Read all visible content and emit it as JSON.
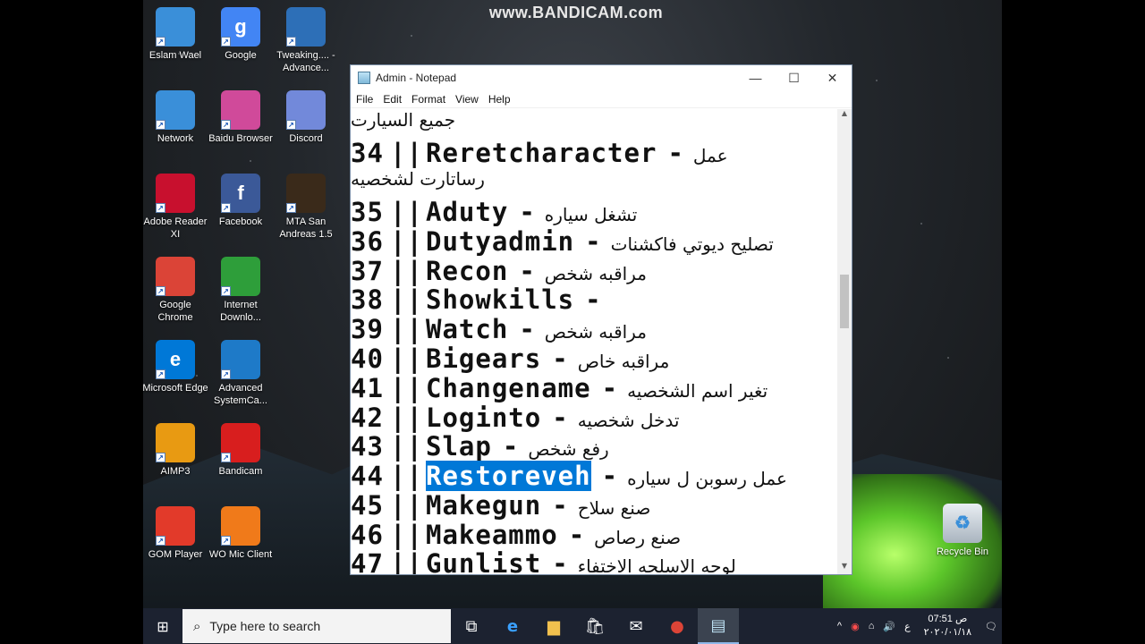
{
  "watermark": "www.BANDICAM.com",
  "desktop_icons": [
    {
      "label": "Eslam Wael",
      "icon": "computer-icon",
      "color": "#3a8fd9"
    },
    {
      "label": "Google",
      "icon": "google-icon",
      "color": "#4285f4",
      "glyph": "g"
    },
    {
      "label": "Tweaking.... - Advance...",
      "icon": "tweaking-icon",
      "color": "#2d6fb7"
    },
    {
      "label": "Network",
      "icon": "network-icon",
      "color": "#3a8fd9"
    },
    {
      "label": "Baidu Browser",
      "icon": "baidu-icon",
      "color": "#d04a9a"
    },
    {
      "label": "Discord",
      "icon": "discord-icon",
      "color": "#7289da"
    },
    {
      "label": "Adobe Reader XI",
      "icon": "adobe-reader-icon",
      "color": "#c8102e"
    },
    {
      "label": "Facebook",
      "icon": "facebook-icon",
      "color": "#3b5998",
      "glyph": "f"
    },
    {
      "label": "MTA San Andreas 1.5",
      "icon": "mta-icon",
      "color": "#3a2a1a"
    },
    {
      "label": "Google Chrome",
      "icon": "chrome-icon",
      "color": "#db4437"
    },
    {
      "label": "Internet Downlo...",
      "icon": "idm-icon",
      "color": "#2e9e3a"
    },
    {
      "label": "Microsoft Edge",
      "icon": "edge-icon",
      "color": "#0078d7",
      "glyph": "e"
    },
    {
      "label": "Advanced SystemCa...",
      "icon": "advanced-systemcare-icon",
      "color": "#1e7ac8"
    },
    {
      "label": "AIMP3",
      "icon": "aimp-icon",
      "color": "#e89a12"
    },
    {
      "label": "Bandicam",
      "icon": "bandicam-icon",
      "color": "#d81e1e"
    },
    {
      "label": "GOM Player",
      "icon": "gom-player-icon",
      "color": "#e23a2a"
    },
    {
      "label": "WO Mic Client",
      "icon": "wo-mic-icon",
      "color": "#f07a1a"
    }
  ],
  "recycle_bin": {
    "label": "Recycle Bin",
    "icon": "recycle-bin-icon"
  },
  "notepad": {
    "title": "Admin - Notepad",
    "menu": [
      "File",
      "Edit",
      "Format",
      "View",
      "Help"
    ],
    "lines": [
      {
        "type": "arabic",
        "text": "جميع السيارت"
      },
      {
        "type": "code",
        "num": "34",
        "bars": "||",
        "cmd": "Reretcharacter",
        "dash": "-",
        "desc": "عمل"
      },
      {
        "type": "arabic",
        "text": "رساتارت لشخصيه"
      },
      {
        "type": "code",
        "num": "35",
        "bars": "||",
        "cmd": "Aduty",
        "dash": "-",
        "desc": "تشغل سياره"
      },
      {
        "type": "code",
        "num": "36",
        "bars": "||",
        "cmd": "Dutyadmin",
        "dash": "-",
        "desc": "تصليح ديوتي فاكشنات"
      },
      {
        "type": "code",
        "num": "37",
        "bars": "||",
        "cmd": "Recon",
        "dash": "-",
        "desc": "مراقبه شخص"
      },
      {
        "type": "code",
        "num": "38",
        "bars": "||",
        "cmd": "Showkills",
        "dash": "-",
        "desc": ""
      },
      {
        "type": "code",
        "num": "39",
        "bars": "||",
        "cmd": "Watch",
        "dash": "-",
        "desc": "مراقبه شخص"
      },
      {
        "type": "code",
        "num": "40",
        "bars": "||",
        "cmd": "Bigears",
        "dash": "-",
        "desc": "مراقبه خاص"
      },
      {
        "type": "code",
        "num": "41",
        "bars": "||",
        "cmd": "Changename",
        "dash": "-",
        "desc": "تغير اسم الشخصيه"
      },
      {
        "type": "code",
        "num": "42",
        "bars": "||",
        "cmd": "Loginto",
        "dash": "-",
        "desc": "تدخل شخصيه"
      },
      {
        "type": "code",
        "num": "43",
        "bars": "||",
        "cmd": "Slap",
        "dash": "-",
        "desc": "رفع شخص"
      },
      {
        "type": "code",
        "num": "44",
        "bars": "||",
        "cmd": "Restoreveh",
        "dash": "-",
        "desc": "عمل رسوبن ل سياره",
        "selected": true
      },
      {
        "type": "code",
        "num": "45",
        "bars": "||",
        "cmd": "Makegun",
        "dash": "-",
        "desc": "صنع سلاح"
      },
      {
        "type": "code",
        "num": "46",
        "bars": "||",
        "cmd": "Makeammo",
        "dash": "-",
        "desc": "صنع رصاص"
      },
      {
        "type": "code",
        "num": "47",
        "bars": "||",
        "cmd": "Gunlist",
        "dash": "-",
        "desc": "لوحه الاسلحه الاختفاء"
      }
    ]
  },
  "taskbar": {
    "search_placeholder": "Type here to search",
    "apps": [
      "task-view-icon",
      "edge-icon",
      "file-explorer-icon",
      "store-icon",
      "mail-icon",
      "chrome-icon",
      "notepad-icon"
    ],
    "tray": {
      "lang": "ع",
      "time": "07:51 ص",
      "date": "٢٠٢٠/٠١/١٨"
    }
  }
}
